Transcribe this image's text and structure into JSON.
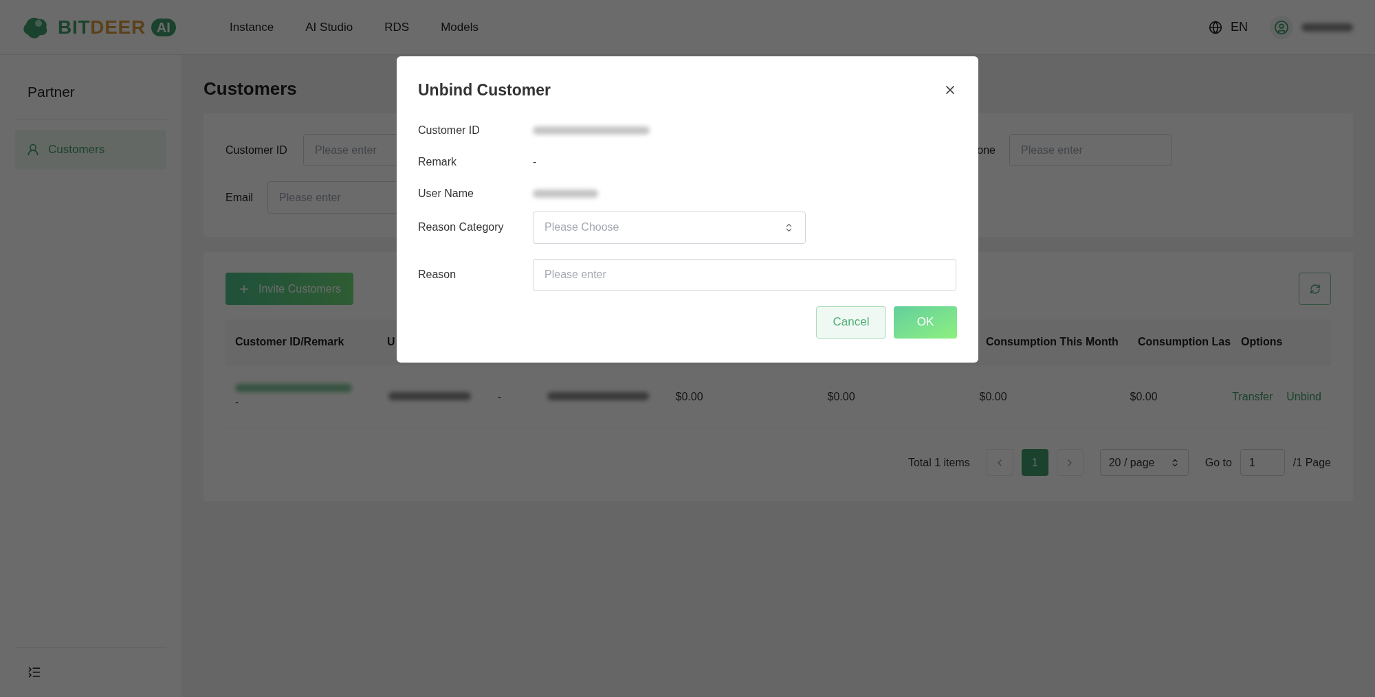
{
  "header": {
    "logo": {
      "text_a": "BIT",
      "text_b": "DEER",
      "badge": "AI"
    },
    "nav": [
      "Instance",
      "AI Studio",
      "RDS",
      "Models"
    ],
    "language": "EN"
  },
  "sidebar": {
    "title": "Partner",
    "items": [
      {
        "label": "Customers",
        "selected": true
      }
    ]
  },
  "page": {
    "title": "Customers",
    "filters": [
      {
        "label": "Customer ID",
        "placeholder": "Please enter"
      },
      {
        "label": "one",
        "placeholder": "Please enter"
      },
      {
        "label": "Email",
        "placeholder": "Please enter"
      }
    ],
    "invite_button": "Invite Customers",
    "table": {
      "columns_left": [
        "Customer ID/Remark",
        "U"
      ],
      "columns_right": [
        "Consumption This Month",
        "Consumption Las",
        "Options"
      ],
      "rows": [
        {
          "cells": [
            {
              "kind": "id",
              "sub": "-"
            },
            {
              "kind": "blurred"
            },
            {
              "kind": "text",
              "text": "-"
            },
            {
              "kind": "blurred"
            },
            {
              "kind": "text",
              "text": "$0.00"
            },
            {
              "kind": "text",
              "text": "$0.00"
            },
            {
              "kind": "text",
              "text": "$0.00"
            },
            {
              "kind": "text",
              "text": "$0.00"
            }
          ],
          "options": [
            "Transfer",
            "Unbind"
          ]
        }
      ]
    },
    "pagination": {
      "total": "Total 1 items",
      "pages": [
        {
          "label": "1",
          "selected": true
        }
      ],
      "page_size": "20 / page",
      "goto_label": "Go to",
      "goto_value": "1",
      "page_count": "/1 Page"
    }
  },
  "dialog": {
    "title": "Unbind Customer",
    "fields": [
      {
        "label": "Customer ID",
        "kind": "blurred"
      },
      {
        "label": "Remark",
        "kind": "text",
        "value": "-"
      },
      {
        "label": "User Name",
        "kind": "blurred"
      }
    ],
    "reason_category": {
      "label": "Reason Category",
      "placeholder": "Please Choose"
    },
    "reason": {
      "label": "Reason",
      "placeholder": "Please enter"
    },
    "buttons": {
      "cancel": "Cancel",
      "ok": "OK"
    }
  }
}
